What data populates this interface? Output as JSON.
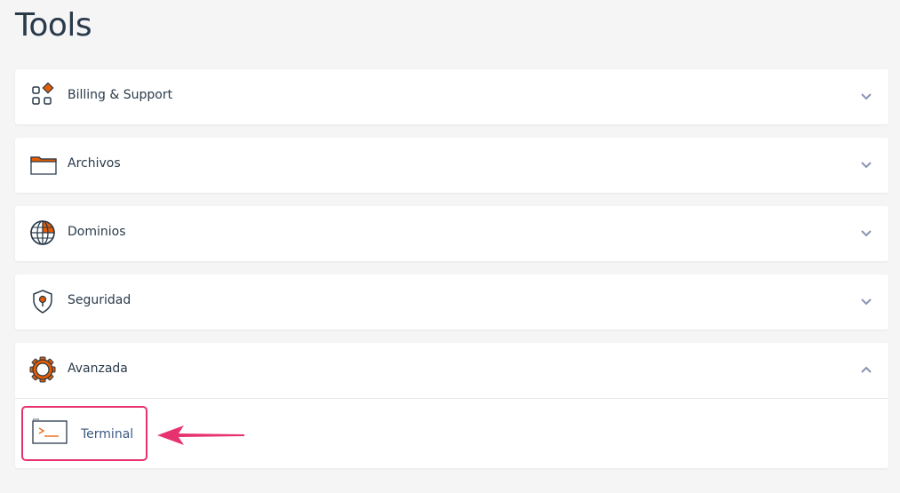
{
  "page": {
    "title": "Tools"
  },
  "panels": [
    {
      "label": "Billing & Support",
      "icon": "billing-grid-icon",
      "expanded": false
    },
    {
      "label": "Archivos",
      "icon": "folder-icon",
      "expanded": false
    },
    {
      "label": "Dominios",
      "icon": "globe-icon",
      "expanded": false
    },
    {
      "label": "Seguridad",
      "icon": "shield-icon",
      "expanded": false
    },
    {
      "label": "Avanzada",
      "icon": "gear-icon",
      "expanded": true
    }
  ],
  "avanzada_items": [
    {
      "label": "Terminal",
      "icon": "terminal-icon",
      "highlighted": true
    }
  ],
  "colors": {
    "accent": "#e65c00",
    "highlight": "#e6336f",
    "chevron": "#8a94b0"
  }
}
